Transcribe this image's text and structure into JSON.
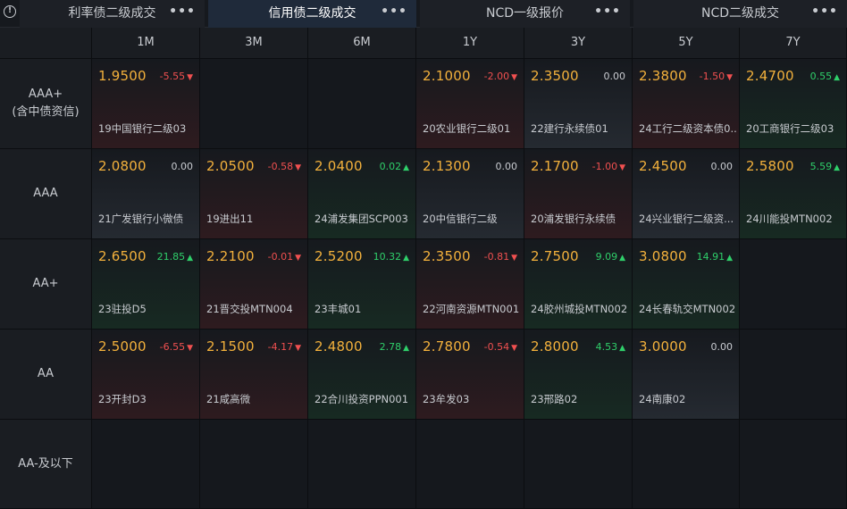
{
  "tabs": [
    {
      "label": "利率债二级成交",
      "active": false
    },
    {
      "label": "信用债二级成交",
      "active": true
    },
    {
      "label": "NCD一级报价",
      "active": false
    },
    {
      "label": "NCD二级成交",
      "active": false
    }
  ],
  "more_glyph": "•••",
  "info_glyph": "!",
  "columns": [
    "1M",
    "3M",
    "6M",
    "1Y",
    "3Y",
    "5Y",
    "7Y"
  ],
  "rows": [
    {
      "label": "AAA+\n(含中债资信)",
      "cells": [
        {
          "price": "1.9500",
          "change": "-5.55",
          "dir": "down",
          "name": "19中国银行二级03"
        },
        null,
        null,
        {
          "price": "2.1000",
          "change": "-2.00",
          "dir": "down",
          "name": "20农业银行二级01"
        },
        {
          "price": "2.3500",
          "change": "0.00",
          "dir": "flat",
          "name": "22建行永续债01"
        },
        {
          "price": "2.3800",
          "change": "-1.50",
          "dir": "down",
          "name": "24工行二级资本债0..."
        },
        {
          "price": "2.4700",
          "change": "0.55",
          "dir": "up",
          "name": "20工商银行二级03"
        }
      ]
    },
    {
      "label": "AAA",
      "cells": [
        {
          "price": "2.0800",
          "change": "0.00",
          "dir": "flat",
          "name": "21广发银行小微债"
        },
        {
          "price": "2.0500",
          "change": "-0.58",
          "dir": "down",
          "name": "19进出11"
        },
        {
          "price": "2.0400",
          "change": "0.02",
          "dir": "up",
          "name": "24浦发集团SCP003"
        },
        {
          "price": "2.1300",
          "change": "0.00",
          "dir": "flat",
          "name": "20中信银行二级"
        },
        {
          "price": "2.1700",
          "change": "-1.00",
          "dir": "down",
          "name": "20浦发银行永续债"
        },
        {
          "price": "2.4500",
          "change": "0.00",
          "dir": "flat",
          "name": "24兴业银行二级资..."
        },
        {
          "price": "2.5800",
          "change": "5.59",
          "dir": "up",
          "name": "24川能投MTN002"
        }
      ]
    },
    {
      "label": "AA+",
      "cells": [
        {
          "price": "2.6500",
          "change": "21.85",
          "dir": "up",
          "name": "23驻投D5"
        },
        {
          "price": "2.2100",
          "change": "-0.01",
          "dir": "down",
          "name": "21晋交投MTN004"
        },
        {
          "price": "2.5200",
          "change": "10.32",
          "dir": "up",
          "name": "23丰城01"
        },
        {
          "price": "2.3500",
          "change": "-0.81",
          "dir": "down",
          "name": "22河南资源MTN001"
        },
        {
          "price": "2.7500",
          "change": "9.09",
          "dir": "up",
          "name": "24胶州城投MTN002"
        },
        {
          "price": "3.0800",
          "change": "14.91",
          "dir": "up",
          "name": "24长春轨交MTN002"
        },
        null
      ]
    },
    {
      "label": "AA",
      "cells": [
        {
          "price": "2.5000",
          "change": "-6.55",
          "dir": "down",
          "name": "23开封D3"
        },
        {
          "price": "2.1500",
          "change": "-4.17",
          "dir": "down",
          "name": "21咸高微"
        },
        {
          "price": "2.4800",
          "change": "2.78",
          "dir": "up",
          "name": "22合川投资PPN001"
        },
        {
          "price": "2.7800",
          "change": "-0.54",
          "dir": "down",
          "name": "23牟发03"
        },
        {
          "price": "2.8000",
          "change": "4.53",
          "dir": "up",
          "name": "23邢路02"
        },
        {
          "price": "3.0000",
          "change": "0.00",
          "dir": "flat",
          "name": "24南康02"
        },
        null
      ]
    },
    {
      "label": "AA-及以下",
      "cells": [
        null,
        null,
        null,
        null,
        null,
        null,
        null
      ]
    }
  ],
  "colors": {
    "price": "#f3b13c",
    "up": "#2fcf6a",
    "down": "#f05050",
    "flat": "#c8cbd0",
    "active_tab": "#1f2a3a"
  }
}
